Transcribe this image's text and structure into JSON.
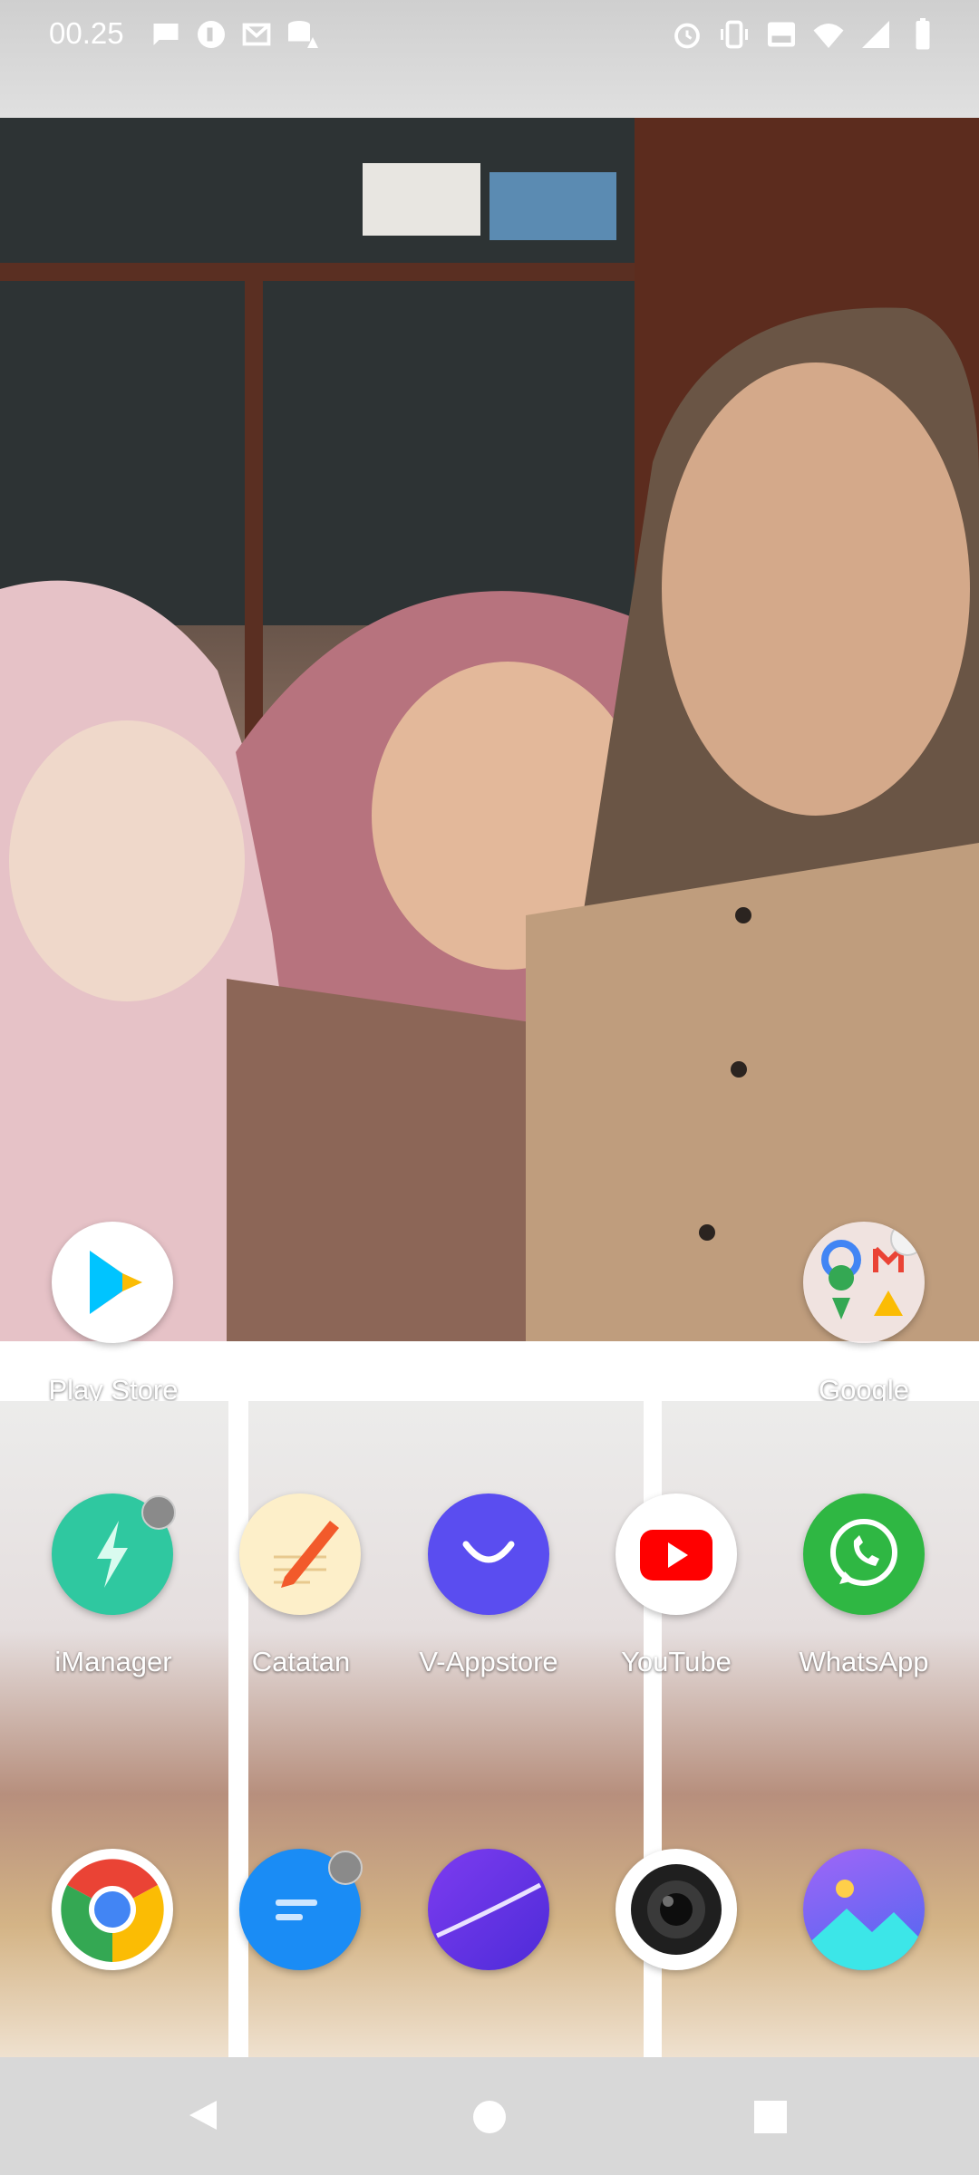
{
  "status_bar": {
    "time": "00.25",
    "left_icons": [
      "message-icon",
      "pocket-icon",
      "gmail-icon",
      "database-alert-icon"
    ],
    "right_icons": [
      "alarm-icon",
      "vibrate-icon",
      "volte-icon",
      "wifi-icon",
      "signal-icon",
      "battery-icon"
    ]
  },
  "dock_top": {
    "play_store": "Play Store",
    "google_folder": "Google"
  },
  "apps_row1": [
    {
      "label": "iManager"
    },
    {
      "label": "Catatan"
    },
    {
      "label": "V-Appstore"
    },
    {
      "label": "YouTube"
    },
    {
      "label": "WhatsApp"
    }
  ],
  "apps_row2": [
    "chrome-icon",
    "messages-icon",
    "browser-icon",
    "camera-icon",
    "gallery-icon"
  ],
  "nav": [
    "back-icon",
    "home-icon",
    "recents-icon"
  ]
}
